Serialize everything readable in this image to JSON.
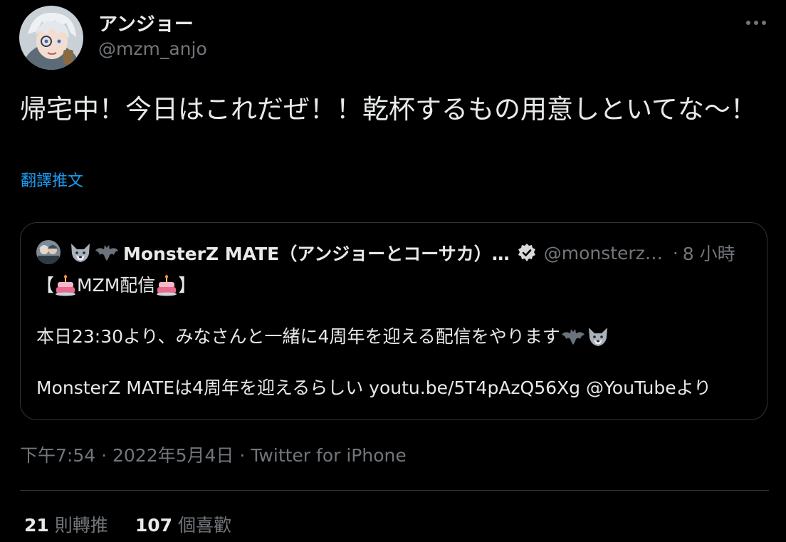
{
  "author": {
    "display_name": "アンジョー",
    "handle": "@mzm_anjo"
  },
  "tweet": {
    "text": "帰宅中！今日はこれだぜ！！乾杯するもの用意しといてな〜！",
    "translate_label": "翻譯推文",
    "time": "下午7:54",
    "date": "2022年5月4日",
    "source": "Twitter for iPhone",
    "separator": "·"
  },
  "quote": {
    "author_name": "MonsterZ MATE（アンジョーとコーサカ）…",
    "handle": "@monsterz…",
    "separator": "·",
    "time": "8 小時",
    "line1_prefix": "【",
    "line1_text": "MZM配信",
    "line1_suffix": "】",
    "line2": "本日23:30より、みなさんと一緒に4周年を迎える配信をやります",
    "line3": "MonsterZ MATEは4周年を迎えるらしい youtu.be/5T4pAzQ56Xg @YouTubeより"
  },
  "stats": {
    "retweets_count": "21",
    "retweets_label": "則轉推",
    "likes_count": "107",
    "likes_label": "個喜歡"
  },
  "colors": {
    "background": "#000000",
    "text_primary": "#e7e9ea",
    "text_secondary": "#71767b",
    "link": "#1d9bf0",
    "border": "#2f3336"
  },
  "icons": {
    "more": "more-horizontal-icon",
    "verified": "verified-badge-icon",
    "wolf": "wolf-emoji-icon",
    "bat": "bat-emoji-icon",
    "cake": "birthday-cake-emoji-icon"
  }
}
